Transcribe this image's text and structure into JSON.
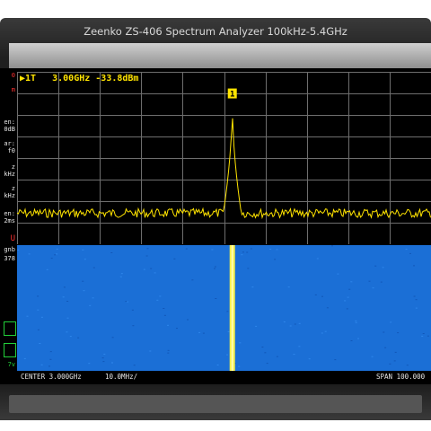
{
  "device": {
    "title": "Zeenko ZS-406   Spectrum Analyzer  100kHz-5.4GHz"
  },
  "marker": {
    "info": "▶1T   3.00GHz -33.8dBm",
    "label": "1",
    "frequency": "3.00GHz",
    "level": "-33.8dBm"
  },
  "sidebar": {
    "items": [
      {
        "text": "0",
        "color": "#ff3030"
      },
      {
        "text": "m",
        "color": "#ff3030"
      },
      {
        "text": "en:\n0dB",
        "color": "#e6e6e6"
      },
      {
        "text": "ar:\nf0",
        "color": "#e6e6e6"
      },
      {
        "text": "z\nkHz",
        "color": "#e6e6e6"
      },
      {
        "text": "z\nkHz",
        "color": "#e6e6e6"
      },
      {
        "text": "en:\n2ms",
        "color": "#e6e6e6"
      },
      {
        "text": "U",
        "color": "#ff3030"
      },
      {
        "text": "gnb",
        "color": "#e6e6e6"
      },
      {
        "text": "378",
        "color": "#e6e6e6"
      },
      {
        "text": "7v",
        "color": "#22d03a"
      }
    ]
  },
  "bottom": {
    "center": "CENTER 3.000GHz",
    "div": "10.0MHz/",
    "span": "SPAN 100.000"
  },
  "colors": {
    "trace": "#ffe400",
    "grid": "#6e6e6e",
    "waterfall": "#1b6fd6"
  },
  "spectrum": {
    "noise_floor_fraction": 0.82,
    "peak_fraction": 0.18,
    "peak_position_fraction": 0.52
  }
}
